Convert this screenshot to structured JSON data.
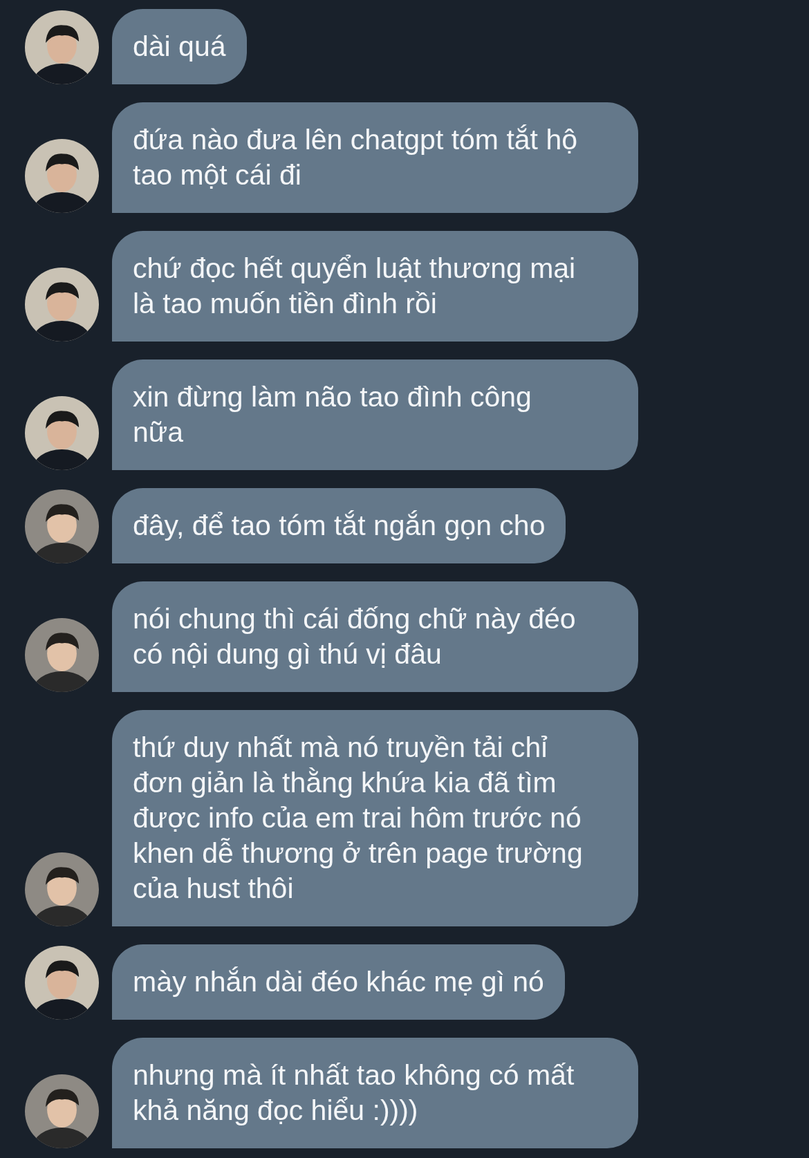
{
  "messages": [
    {
      "kind": "a",
      "lines": [
        "dài quá"
      ]
    },
    {
      "kind": "a",
      "lines": [
        "đứa nào đưa lên chatgpt tóm tắt hộ",
        "tao một cái đi"
      ]
    },
    {
      "kind": "a",
      "lines": [
        "chứ đọc hết quyển luật thương mại",
        "là tao muốn tiền đình rồi"
      ]
    },
    {
      "kind": "a",
      "lines": [
        "xin đừng làm não tao đình công",
        "nữa"
      ]
    },
    {
      "kind": "b",
      "lines": [
        "đây, để tao tóm tắt ngắn gọn cho"
      ]
    },
    {
      "kind": "b",
      "lines": [
        "nói chung thì cái đống chữ này đéo",
        "có nội dung gì thú vị đâu"
      ]
    },
    {
      "kind": "b",
      "lines": [
        "thứ duy nhất mà nó truyền tải chỉ",
        "đơn giản là thằng khứa kia đã tìm",
        "được info của em trai hôm trước nó",
        "khen dễ thương ở trên page trường",
        "của hust thôi"
      ]
    },
    {
      "kind": "a",
      "lines": [
        "mày nhắn dài đéo khác mẹ gì nó"
      ]
    },
    {
      "kind": "b",
      "lines": [
        "nhưng mà ít nhất tao không có mất",
        "khả năng đọc hiểu :))))"
      ]
    }
  ]
}
